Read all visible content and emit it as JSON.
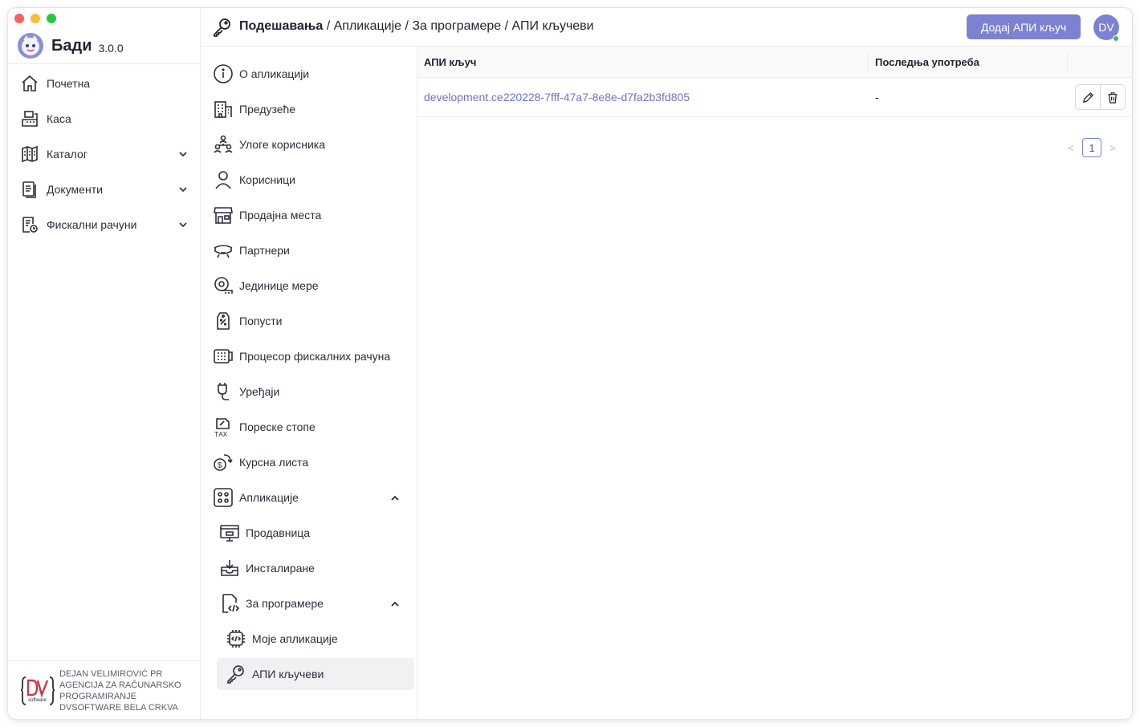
{
  "app": {
    "name": "Бади",
    "version": "3.0.0"
  },
  "sidebar": {
    "items": [
      {
        "label": "Почетна",
        "icon": "home-icon"
      },
      {
        "label": "Каса",
        "icon": "cash-register-icon"
      },
      {
        "label": "Каталог",
        "icon": "catalog-icon",
        "expandable": true
      },
      {
        "label": "Документи",
        "icon": "documents-icon",
        "expandable": true
      },
      {
        "label": "Фискални рачуни",
        "icon": "fiscal-receipt-icon",
        "expandable": true
      }
    ],
    "company_lines": [
      "DEJAN VELIMIROVIĆ PR",
      "AGENCIJA ZA RAČUNARSKO",
      "PROGRAMIRANJE",
      "DVSOFTWARE BELA CRKVA"
    ]
  },
  "header": {
    "breadcrumb_root": "Подешавања",
    "breadcrumb_rest": " / Апликације / За програмере / АПИ кључеви",
    "add_button": "Додај АПИ кључ",
    "avatar_initials": "DV"
  },
  "settings_menu": {
    "items": [
      {
        "label": "О апликацији",
        "icon": "info-icon"
      },
      {
        "label": "Предузеће",
        "icon": "building-icon"
      },
      {
        "label": "Улоге корисника",
        "icon": "user-roles-icon"
      },
      {
        "label": "Корисници",
        "icon": "user-icon"
      },
      {
        "label": "Продајна места",
        "icon": "store-icon"
      },
      {
        "label": "Партнери",
        "icon": "partners-icon"
      },
      {
        "label": "Јединице мере",
        "icon": "measure-tape-icon"
      },
      {
        "label": "Попусти",
        "icon": "discount-tag-icon"
      },
      {
        "label": "Процесор фискалних рачуна",
        "icon": "fiscal-processor-icon"
      },
      {
        "label": "Уређаји",
        "icon": "device-icon"
      },
      {
        "label": "Пореске стопе",
        "icon": "tax-icon"
      },
      {
        "label": "Курсна листа",
        "icon": "exchange-rate-icon"
      },
      {
        "label": "Апликације",
        "icon": "apps-icon",
        "expanded": true
      },
      {
        "label": "Продавница",
        "icon": "app-store-icon"
      },
      {
        "label": "Инсталиране",
        "icon": "installed-icon"
      },
      {
        "label": "За програмере",
        "icon": "developer-icon",
        "expanded": true
      },
      {
        "label": "Моје апликације",
        "icon": "chip-icon"
      },
      {
        "label": "АПИ кључеви",
        "icon": "key-icon",
        "active": true
      }
    ]
  },
  "table": {
    "columns": [
      "АПИ кључ",
      "Последња употреба"
    ],
    "rows": [
      {
        "key": "development.ce220228-7fff-47a7-8e8e-d7fa2b3fd805",
        "last_used": "-"
      }
    ]
  },
  "pagination": {
    "current_page": "1",
    "prev": "<",
    "next": ">"
  },
  "colors": {
    "accent": "#7c81d2",
    "link": "#6e73c8",
    "online": "#3dbb61"
  }
}
